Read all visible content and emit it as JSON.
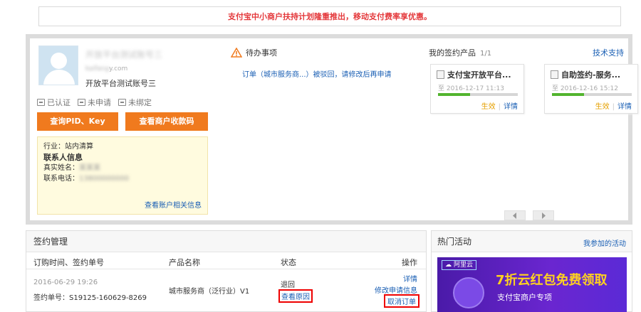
{
  "notice": "支付宝中小商户扶持计划隆重推出，移动支付费率享优惠。",
  "account": {
    "name": "开放平台测试账号三",
    "email_prefix": "kaifang",
    "email_suffix": "y.com",
    "label": "开放平台测试账号三",
    "status": [
      "已认证",
      "未申请",
      "未绑定"
    ],
    "btn_pid": "查询PID、Key",
    "btn_qr": "查看商户收款码",
    "industry": "行业：站内清算",
    "contact_title": "联系人信息",
    "real_name_label": "真实姓名：",
    "real_name": "某某某",
    "phone_label": "联系电话：",
    "phone": "13800000000",
    "info_link": "查看账户相关信息"
  },
  "todo": {
    "title": "待办事项",
    "item": "订单（城市服务商...）被驳回，请修改后再申请"
  },
  "products": {
    "title": "我的签约产品",
    "page": "1/1",
    "support": "技术支持",
    "progress": 0.4,
    "cards": [
      {
        "name": "支付宝开放平台...",
        "date_prefix": "至",
        "date": "2016-12-17 11:13",
        "status": "生效",
        "detail": "详情"
      },
      {
        "name": "自助签约-服务...",
        "date_prefix": "至",
        "date": "2016-12-16 15:12",
        "status": "生效",
        "detail": "详情"
      }
    ]
  },
  "sign": {
    "title": "签约管理",
    "cols": [
      "订购时间、签约单号",
      "产品名称",
      "状态",
      "操作"
    ],
    "row": {
      "date": "2016-06-29 19:26",
      "num": "签约单号：S19125-160629-8269",
      "product": "城市服务商（泛行业）V1",
      "status": "退回",
      "reason": "查看原因",
      "op_detail": "详情",
      "op_modify": "修改申请信息",
      "op_cancel": "取消订单"
    }
  },
  "hot": {
    "title": "热门活动",
    "link": "我参加的活动",
    "banner_logo": "阿里云",
    "banner_title": "7折云红包免费领取",
    "banner_sub": "支付宝商户专项"
  },
  "colors": {
    "accent": "#f07a1e",
    "link": "#1a5fb4",
    "alert": "#e4393c",
    "effective": "#e5a000",
    "progress": "#52b42e"
  }
}
